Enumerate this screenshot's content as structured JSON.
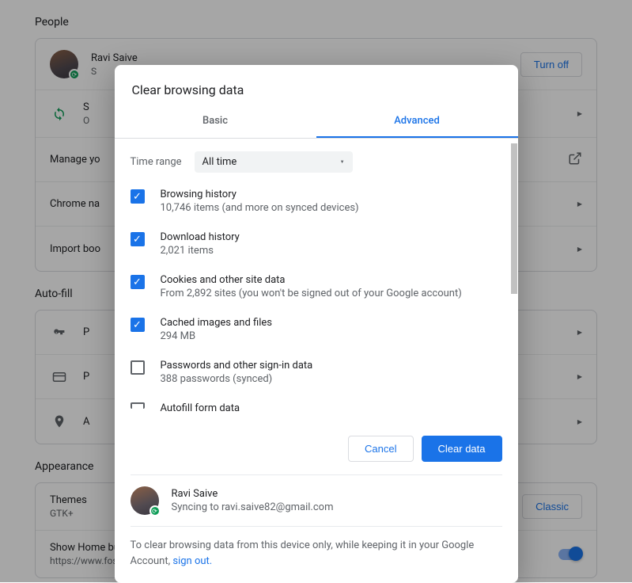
{
  "bg": {
    "people": {
      "title": "People",
      "profile": {
        "name": "Ravi Saive",
        "sub": "S",
        "turn_off": "Turn off"
      },
      "sync_item": {
        "title": "S",
        "sub": "O"
      },
      "manage": "Manage yo",
      "chrome_name": "Chrome na",
      "import": "Import boo"
    },
    "autofill": {
      "title": "Auto-fill",
      "rows": [
        "P",
        "P",
        "A"
      ]
    },
    "appearance": {
      "title": "Appearance",
      "themes": {
        "title": "Themes",
        "sub": "GTK+",
        "reset": "Classic"
      },
      "home": {
        "title": "Show Home button",
        "sub": "https://www.fossmint.com/"
      }
    }
  },
  "dialog": {
    "title": "Clear browsing data",
    "tabs": {
      "basic": "Basic",
      "advanced": "Advanced"
    },
    "time_range_label": "Time range",
    "time_range_value": "All time",
    "options": [
      {
        "title": "Browsing history",
        "sub": "10,746 items (and more on synced devices)",
        "checked": true
      },
      {
        "title": "Download history",
        "sub": "2,021 items",
        "checked": true
      },
      {
        "title": "Cookies and other site data",
        "sub": "From 2,892 sites (you won't be signed out of your Google account)",
        "checked": true
      },
      {
        "title": "Cached images and files",
        "sub": "294 MB",
        "checked": true
      },
      {
        "title": "Passwords and other sign-in data",
        "sub": "388 passwords (synced)",
        "checked": false
      },
      {
        "title": "Autofill form data",
        "sub": "",
        "checked": false
      }
    ],
    "cancel": "Cancel",
    "clear": "Clear data",
    "footer": {
      "name": "Ravi Saive",
      "sync": "Syncing to ravi.saive82@gmail.com",
      "note_pre": "To clear browsing data from this device only, while keeping it in your Google Account, ",
      "sign_out": "sign out."
    }
  }
}
